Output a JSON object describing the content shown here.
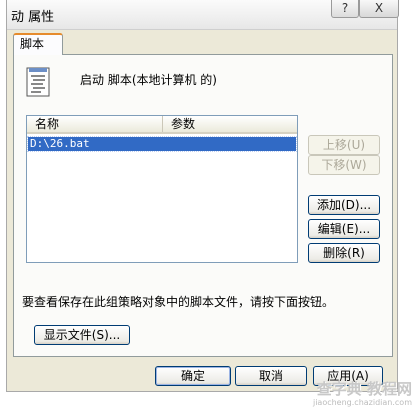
{
  "window": {
    "title": "动 属性",
    "help_label": "?",
    "close_label": "X"
  },
  "tabs": [
    {
      "label": "脚本"
    }
  ],
  "header": {
    "icon": "script-document-icon",
    "text": "启动 脚本(本地计算机 的)"
  },
  "script_list": {
    "columns": [
      "名称",
      "参数"
    ],
    "rows": [
      {
        "name": "D:\\26.bat",
        "params": "",
        "selected": true
      }
    ]
  },
  "side_buttons": {
    "up": "上移(U)",
    "down": "下移(W)",
    "add": "添加(D)...",
    "edit": "编辑(E)...",
    "remove": "删除(R)"
  },
  "info_text": "要查看保存在此组策略对象中的脚本文件，请按下面按钮。",
  "show_files_label": "显示文件(S)...",
  "footer": {
    "ok": "确定",
    "cancel": "取消",
    "apply": "应用(A)"
  },
  "watermark": {
    "main": "查字典 教程网",
    "sub": "jiaocheng.chazidian.com"
  },
  "colors": {
    "dialog_bg": "#ece9d8",
    "selection": "#316ac5",
    "tab_accent": "#e68b2c",
    "button_border": "#003c74"
  }
}
